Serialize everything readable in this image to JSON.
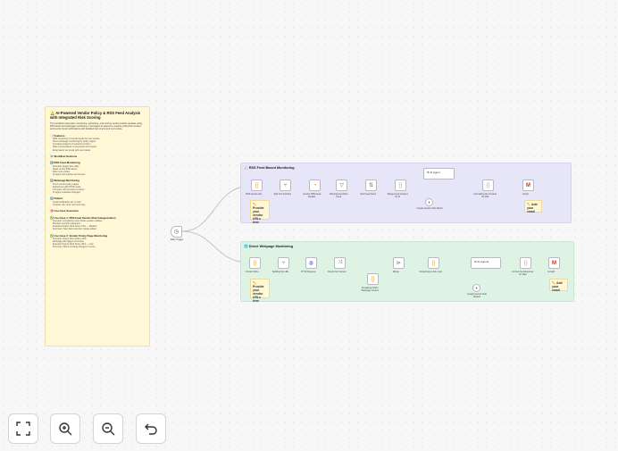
{
  "note": {
    "title": "🔔 AI-Powered Vendor Policy & RSS Feed Analysis with Integrated Risk Scoring",
    "intro": "This workflow automates monitoring, extracting, and scoring vendor-related updates using RSS feeds and webpage monitoring. It leverages AI agents to analyze policy/risk content and sends Gmail notifications with detailed risk scores and summaries.",
    "features_heading": "📝 Features",
    "features": [
      "RSS monitoring of vendor feeds for new entries",
      "Direct webpage monitoring for policy pages",
      "AI-based analysis of extracted content",
      "Risk scoring based on keywords and impact",
      "Email alerts via Gmail with summaries"
    ],
    "workflow_heading": "⚙️ Workflow Sections",
    "rss_heading": "1️⃣ RSS Feed Monitoring",
    "rss_items": [
      "Schedule trigger fires daily",
      "Read vendor RSS feeds",
      "Filter new entries",
      "AI agent summarizes and scores"
    ],
    "web_heading": "2️⃣ Webpage Monitoring",
    "web_items": [
      "Fetch vendor policy pages",
      "Extract text with HTML node",
      "Compare with previous versions",
      "AI agent evaluates changes"
    ],
    "output_heading": "3️⃣ Output",
    "output_items": [
      "Gmail notification per vendor",
      "Includes risk score and summary"
    ],
    "usecase_heading": "🎯 Use Case Scenarios",
    "usecase1_heading": "✅ Use Case 1: RSS Feed Vendor Risk Categorization",
    "usecase1_items": [
      "Scenario: compliance team tracks vendor updates",
      "Monitors security advisories",
      "Example Output: Risk Score 7/10 — Medium",
      "Summary: New data retention clause added"
    ],
    "usecase2_heading": "✅ Use Case 2: Vendor Policy Page Monitoring",
    "usecase2_items": [
      "Scenario: detect silent policy edits",
      "Webpage diff triggers AI review",
      "Example Output: Risk Score 4/10 — Low",
      "Summary: Minor wording changes in terms"
    ]
  },
  "trigger": {
    "label": "Daily Trigger",
    "icon": "clock-icon"
  },
  "group_rss": {
    "title": "📰 RSS Feed Based Monitoring",
    "nodes": [
      "RSS Feed Links",
      "Split Out Vendors",
      "Vendor RSS Feed Reader",
      "Filtering last 24hrs Feed",
      "Sort Feed Items",
      "Merge Feed Content for AI",
      "AI Agent",
      "Formatting the Content for Mail",
      "Gmail"
    ],
    "sub": "Google Gemini Chat Model",
    "sticky1": "✏️ Provide your vendor URLs here",
    "sticky2": "✏️ Add your email"
  },
  "group_web": {
    "title": "🌐 Direct Webpage Monitoring",
    "nodes": [
      "Vendor URLs",
      "Splitting the URL",
      "HTTP Request",
      "Check File Version",
      "Merge",
      "Streaming as File Lists",
      "AI Agent1",
      "Format the Response for Mail",
      "Gmail1"
    ],
    "extra": "Scrapping Article Webpage content",
    "sub": "Google Gemini Chat Model1",
    "sticky1": "✏️ Provide your vendor URLs here",
    "sticky2": "✏️ Add your email"
  },
  "toolbar": {
    "fit": "fit-view-icon",
    "zoom_in": "zoom-in-icon",
    "zoom_out": "zoom-out-icon",
    "undo": "undo-icon"
  }
}
